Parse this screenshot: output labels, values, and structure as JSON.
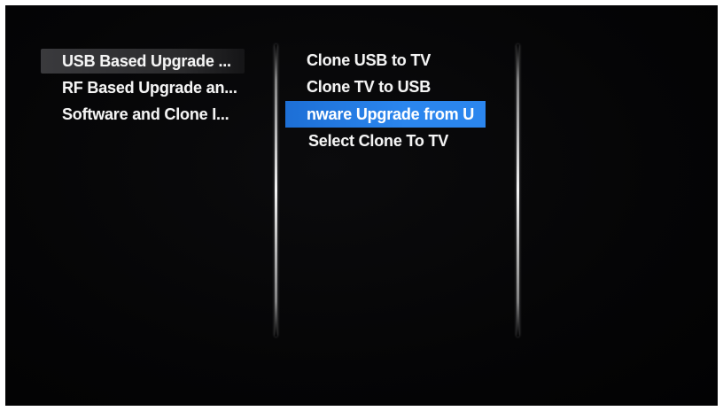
{
  "left_menu": {
    "items": [
      {
        "label": "USB Based Upgrade ..."
      },
      {
        "label": "RF Based Upgrade an..."
      },
      {
        "label": "Software and Clone I..."
      }
    ],
    "selected_index": 0
  },
  "sub_menu": {
    "items": [
      {
        "label": "Clone USB to TV"
      },
      {
        "label": "Clone TV to USB"
      },
      {
        "label": "nware Upgrade from U"
      },
      {
        "label": "Select Clone To TV"
      }
    ],
    "focused_index": 2
  },
  "colors": {
    "background": "#050506",
    "focus_highlight": "#2b86ee",
    "selected_parent": "#3a3a3d",
    "text": "#f4f4f4"
  }
}
